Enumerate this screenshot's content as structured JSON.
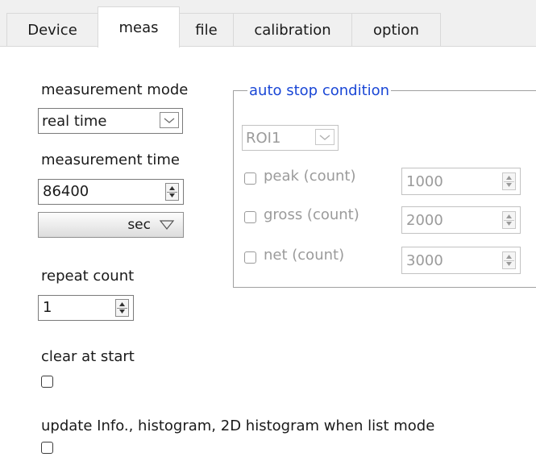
{
  "tabs": [
    "Device",
    "meas",
    "file",
    "calibration",
    "option"
  ],
  "measurement_mode": {
    "label": "measurement mode",
    "value": "real time"
  },
  "measurement_time": {
    "label": "measurement time",
    "value": "86400",
    "unit": "sec"
  },
  "repeat_count": {
    "label": "repeat count",
    "value": "1"
  },
  "clear_at_start": {
    "label": "clear at start",
    "checked": false
  },
  "update_list_mode": {
    "label": "update Info., histogram, 2D histogram when list mode",
    "checked": false
  },
  "auto_stop": {
    "title": "auto stop condition",
    "roi": "ROI1",
    "peak": {
      "label": "peak (count)",
      "value": "1000"
    },
    "gross": {
      "label": "gross (count)",
      "value": "2000"
    },
    "net": {
      "label": "net (count)",
      "value": "3000"
    }
  }
}
